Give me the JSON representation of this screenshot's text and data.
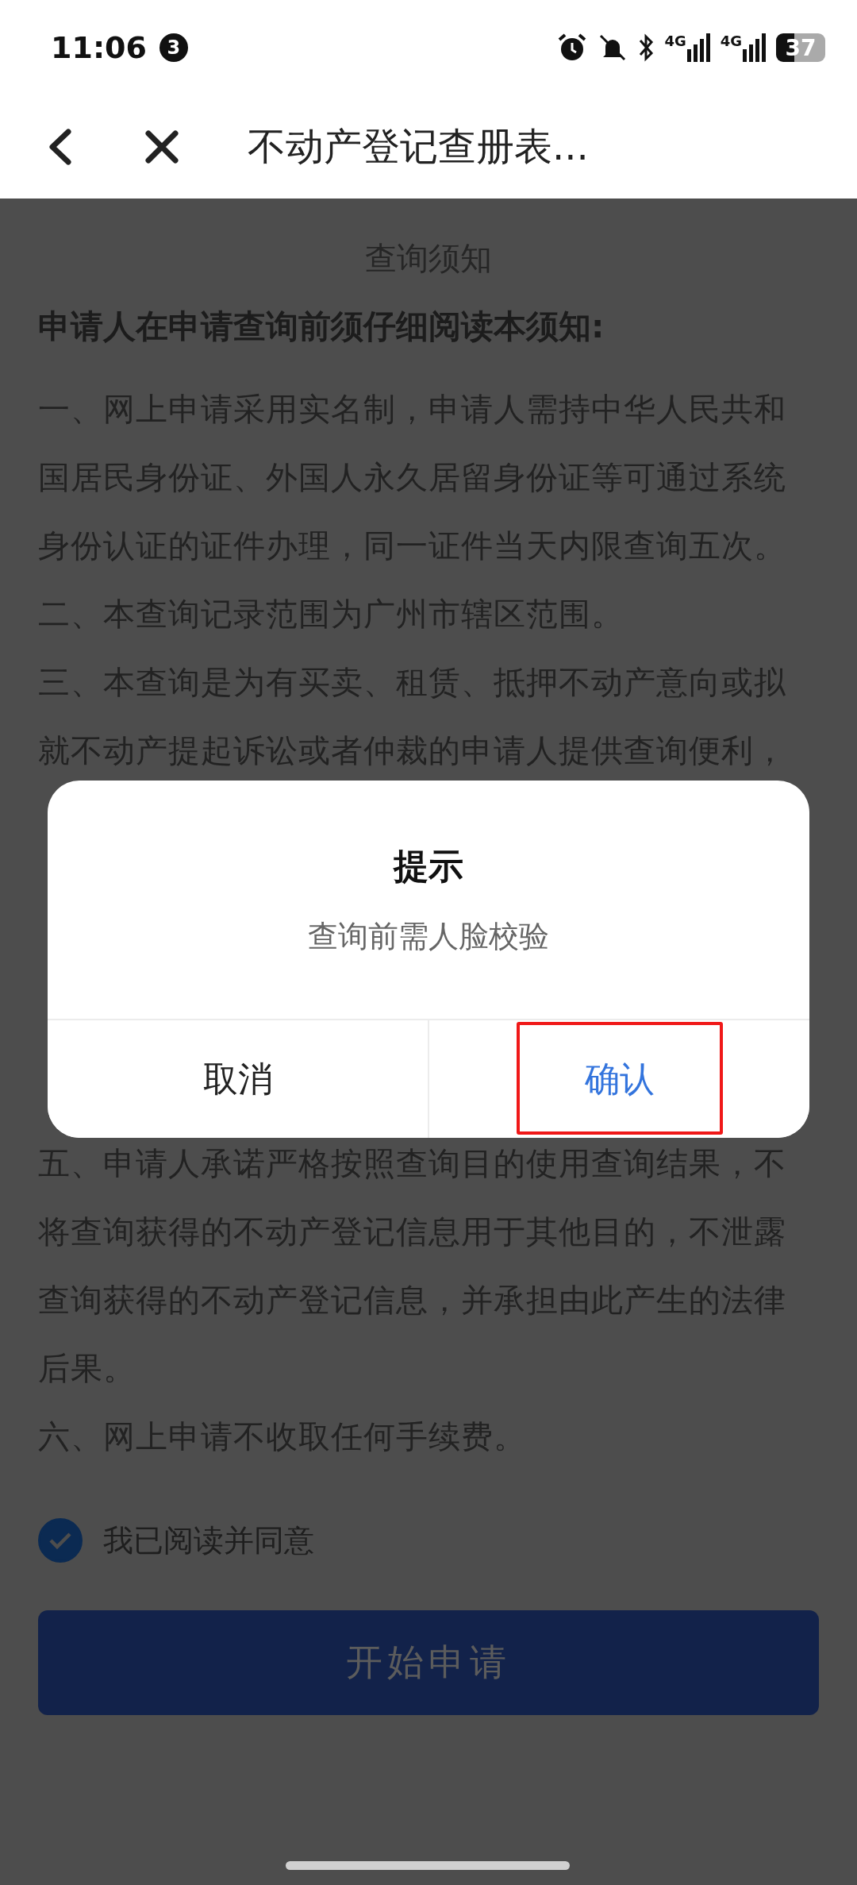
{
  "status_bar": {
    "time": "11:06",
    "notification_count": "3",
    "network_1": "4G",
    "network_2": "4G",
    "battery": "37"
  },
  "header": {
    "title": "不动产登记查册表..."
  },
  "notice": {
    "title": "查询须知",
    "heading": "申请人在申请查询前须仔细阅读本须知:",
    "lines_above": [
      "一、网上申请采用实名制，申请人需持中华人民共和",
      "国居民身份证、外国人永久居留身份证等可通过系统",
      "身份认证的证件办理，同一证件当天内限查询五次。",
      "二、本查询记录范围为广州市辖区范围。",
      "三、本查询是为有买卖、租赁、抵押不动产意向或拟",
      "就不动产提起诉讼或者仲裁的申请人提供查询便利，"
    ],
    "lines_below": [
      "五、申请人承诺严格按照查询目的使用查询结果，不",
      "将查询获得的不动产登记信息用于其他目的，不泄露",
      "查询获得的不动产登记信息，并承担由此产生的法律",
      "后果。",
      "六、网上申请不收取任何手续费。"
    ]
  },
  "agreement": {
    "label": "我已阅读并同意",
    "checked": true
  },
  "submit_button": {
    "label": "开始申请"
  },
  "dialog": {
    "title": "提示",
    "message": "查询前需人脸校验",
    "buttons": [
      {
        "label": "取消",
        "kind": "cancel",
        "highlighted": false
      },
      {
        "label": "确认",
        "kind": "confirm",
        "highlighted": true
      }
    ]
  }
}
